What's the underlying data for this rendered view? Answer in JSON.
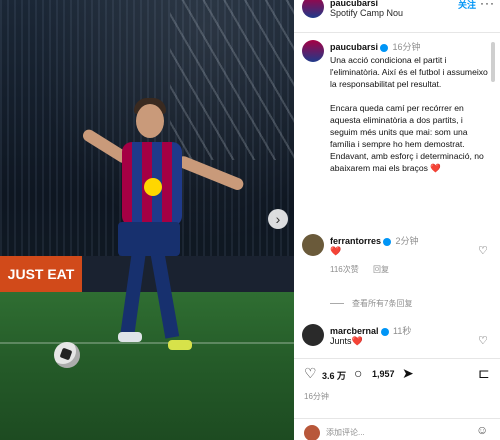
{
  "header": {
    "username": "paucubarsi",
    "location": "Spotify Camp Nou",
    "follow_label": "关注",
    "more_glyph": "···"
  },
  "media": {
    "ad_text": "JUST EAT",
    "next_glyph": "›"
  },
  "post": {
    "username": "paucubarsi",
    "time": "16分钟",
    "paragraph1": "Una acció condiciona el partit i l'eliminatòria. Així és el futbol i assumeixo la responsabilitat pel resultat.",
    "paragraph2": "Encara queda camí per recórrer en aquesta eliminatòria a dos partits, i seguim més units que mai: som una família i sempre ho hem demostrat. Endavant, amb esforç i determinació, no abaixarem mai els braços ❤️"
  },
  "comments": [
    {
      "username": "ferrantorres",
      "time": "2分钟",
      "text": "❤️",
      "likes": "116次赞",
      "reply": "回复",
      "view_replies": "查看所有7条回复"
    },
    {
      "username": "marcbernal",
      "time": "11秒",
      "text": "Junts❤️"
    }
  ],
  "actions": {
    "likes": "3.6 万",
    "comments": "1,957",
    "timestamp": "16分钟"
  },
  "add_comment": {
    "placeholder": "添加评论..."
  },
  "colors": {
    "accent": "#0095f6",
    "heart": "#d11d3d",
    "barca_red": "#a50044",
    "barca_blue": "#1f3a8a"
  }
}
